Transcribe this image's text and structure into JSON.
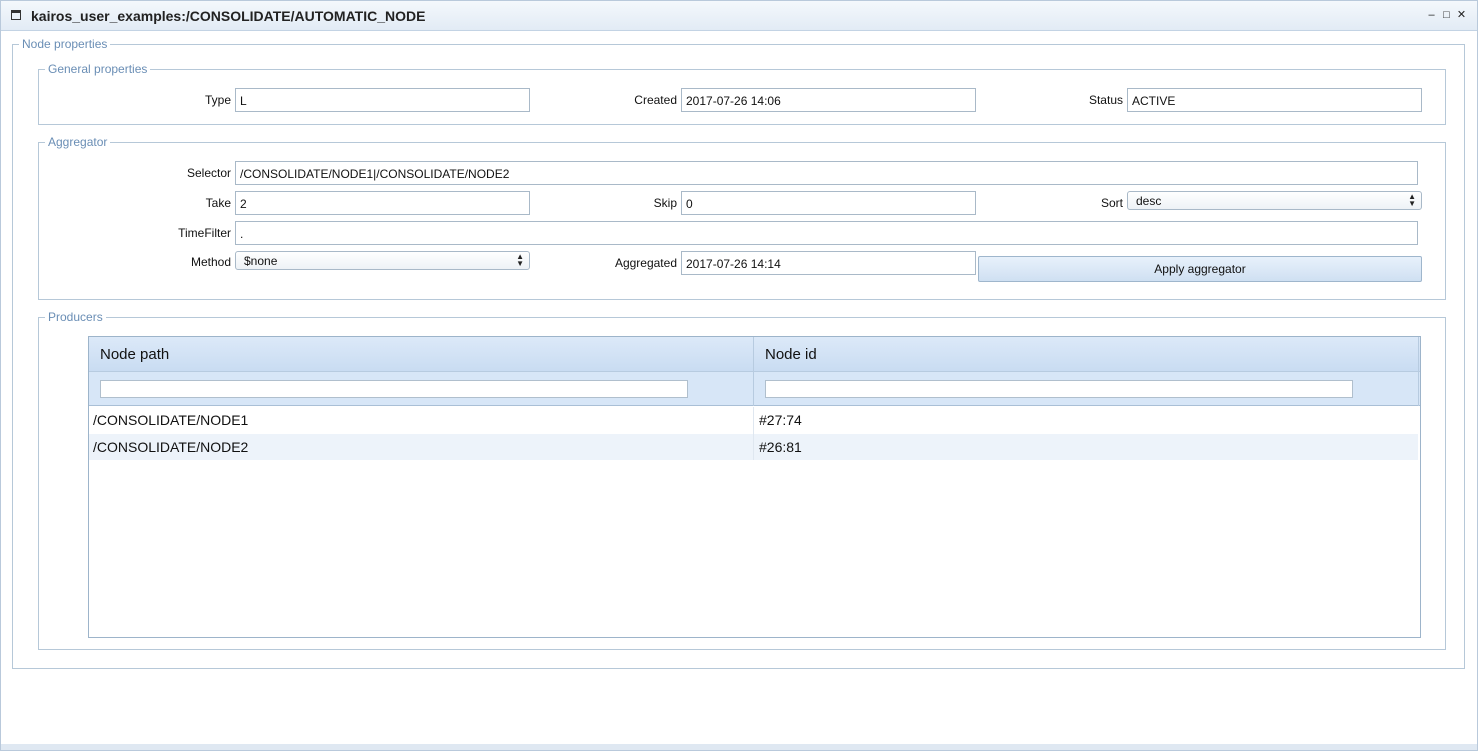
{
  "window": {
    "title": "kairos_user_examples:/CONSOLIDATE/AUTOMATIC_NODE",
    "controls": {
      "minimize": "–",
      "maximize": "□",
      "close": "✕"
    }
  },
  "node_properties": {
    "legend": "Node properties",
    "general": {
      "legend": "General properties",
      "type_label": "Type",
      "type_value": "L",
      "created_label": "Created",
      "created_value": "2017-07-26 14:06",
      "status_label": "Status",
      "status_value": "ACTIVE"
    },
    "aggregator": {
      "legend": "Aggregator",
      "selector_label": "Selector",
      "selector_value": "/CONSOLIDATE/NODE1|/CONSOLIDATE/NODE2",
      "take_label": "Take",
      "take_value": "2",
      "skip_label": "Skip",
      "skip_value": "0",
      "sort_label": "Sort",
      "sort_value": "desc",
      "timefilter_label": "TimeFilter",
      "timefilter_value": ".",
      "method_label": "Method",
      "method_value": "$none",
      "aggregated_label": "Aggregated",
      "aggregated_value": "2017-07-26 14:14",
      "apply_button": "Apply aggregator"
    },
    "producers": {
      "legend": "Producers",
      "columns": [
        "Node path",
        "Node id"
      ],
      "rows": [
        {
          "path": "/CONSOLIDATE/NODE1",
          "id": "#27:74"
        },
        {
          "path": "/CONSOLIDATE/NODE2",
          "id": "#26:81"
        }
      ]
    }
  },
  "colors": {
    "legend": "#6a8eb5",
    "header": "#c9dcf2",
    "border": "#b6c8d8"
  }
}
